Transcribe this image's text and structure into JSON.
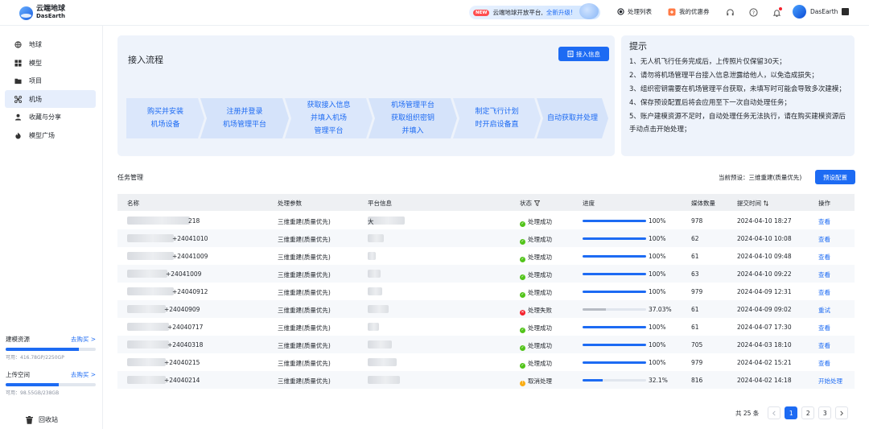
{
  "app": {
    "name_cn": "云端地球",
    "name_en": "DasEarth"
  },
  "topbar": {
    "promo_new": "NEW",
    "promo_text": "云端地球开放平台,",
    "promo_link": "全新升级!",
    "task_list": "处理列表",
    "coupons": "我的优惠券",
    "user_name": "DasEarth"
  },
  "sidebar": {
    "items": [
      {
        "label": "地球"
      },
      {
        "label": "模型"
      },
      {
        "label": "项目"
      },
      {
        "label": "机场"
      },
      {
        "label": "收藏与分享"
      },
      {
        "label": "模型广场"
      }
    ],
    "model_res": {
      "label": "建模资源",
      "link": "去购买 >",
      "sub": "可用：416.78GP/2250GP",
      "fraction": 0.815
    },
    "upload_res": {
      "label": "上传空间",
      "link": "去购买 >",
      "sub": "可用：98.55GB/238GB",
      "fraction": 0.586
    },
    "recycle": "回收站"
  },
  "flow": {
    "title": "接入流程",
    "button": "接入信息",
    "steps": [
      "购买并安装\n机场设备",
      "注册并登录\n机场管理平台",
      "获取接入信息\n并填入机场\n管理平台",
      "机场管理平台\n获取组织密钥\n并填入",
      "制定飞行计划\n时开启设备直",
      "自动获取并处理"
    ]
  },
  "tips": {
    "title": "提示",
    "items": [
      "1、无人机飞行任务完成后，上传照片仅保留30天；",
      "2、请勿将机场管理平台接入信息泄露给他人，以免造成损失；",
      "3、组织密钥需要在机场管理平台获取，未填写时可能会导致多次建模；",
      "4、保存预设配置后将会应用至下一次自动处理任务；",
      "5、账户建模资源不足时，自动处理任务无法执行，请在购买建模资源后手动点击开始处理；"
    ]
  },
  "tasks": {
    "title": "任务管理",
    "preset_label": "当前预设：三维重建(质量优先)",
    "preset_button": "预设配置",
    "headers": {
      "name": "名称",
      "params": "处理参数",
      "platform": "平台信息",
      "status": "状态",
      "progress": "进度",
      "media": "媒体数量",
      "time": "提交时间",
      "op": "操作"
    },
    "rows": [
      {
        "name": "218",
        "params": "三维重建(质量优先)",
        "platform": "大",
        "status": "处理成功",
        "state": "ok",
        "progress": 100,
        "pct": "100%",
        "media": "978",
        "time": "2024-04-10 18:27",
        "op": "查看"
      },
      {
        "name": "+24041010",
        "params": "三维重建(质量优先)",
        "platform": "",
        "status": "处理成功",
        "state": "ok",
        "progress": 100,
        "pct": "100%",
        "media": "62",
        "time": "2024-04-10 10:08",
        "op": "查看"
      },
      {
        "name": "+24041009",
        "params": "三维重建(质量优先)",
        "platform": "",
        "status": "处理成功",
        "state": "ok",
        "progress": 100,
        "pct": "100%",
        "media": "61",
        "time": "2024-04-10 09:48",
        "op": "查看"
      },
      {
        "name": "+24041009",
        "params": "三维重建(质量优先)",
        "platform": "",
        "status": "处理成功",
        "state": "ok",
        "progress": 100,
        "pct": "100%",
        "media": "63",
        "time": "2024-04-10 09:22",
        "op": "查看"
      },
      {
        "name": "+24040912",
        "params": "三维重建(质量优先)",
        "platform": "",
        "status": "处理成功",
        "state": "ok",
        "progress": 100,
        "pct": "100%",
        "media": "979",
        "time": "2024-04-09 12:31",
        "op": "查看"
      },
      {
        "name": "+24040909",
        "params": "三维重建(质量优先)",
        "platform": "",
        "status": "处理失败",
        "state": "fail",
        "progress": 37.03,
        "pct": "37.03%",
        "media": "61",
        "time": "2024-04-09 09:02",
        "op": "重试"
      },
      {
        "name": "+24040717",
        "params": "三维重建(质量优先)",
        "platform": "",
        "status": "处理成功",
        "state": "ok",
        "progress": 100,
        "pct": "100%",
        "media": "61",
        "time": "2024-04-07 17:30",
        "op": "查看"
      },
      {
        "name": "+24040318",
        "params": "三维重建(质量优先)",
        "platform": "",
        "status": "处理成功",
        "state": "ok",
        "progress": 100,
        "pct": "100%",
        "media": "705",
        "time": "2024-04-03 18:10",
        "op": "查看"
      },
      {
        "name": "+24040215",
        "params": "三维重建(质量优先)",
        "platform": "",
        "status": "处理成功",
        "state": "ok",
        "progress": 100,
        "pct": "100%",
        "media": "979",
        "time": "2024-04-02 15:21",
        "op": "查看"
      },
      {
        "name": "+24040214",
        "params": "三维重建(质量优先)",
        "platform": "",
        "status": "取消处理",
        "state": "cancel",
        "progress": 32.1,
        "pct": "32.1%",
        "media": "816",
        "time": "2024-04-02 14:18",
        "op": "开始处理"
      }
    ]
  },
  "pagination": {
    "total": "共 25 条",
    "pages": [
      "1",
      "2",
      "3"
    ],
    "current": "1"
  },
  "colors": {
    "accent": "#1d6bf3",
    "success": "#52c41a",
    "fail": "#f5222d",
    "cancel": "#faad14",
    "fail_bar": "#b7bcc4"
  }
}
